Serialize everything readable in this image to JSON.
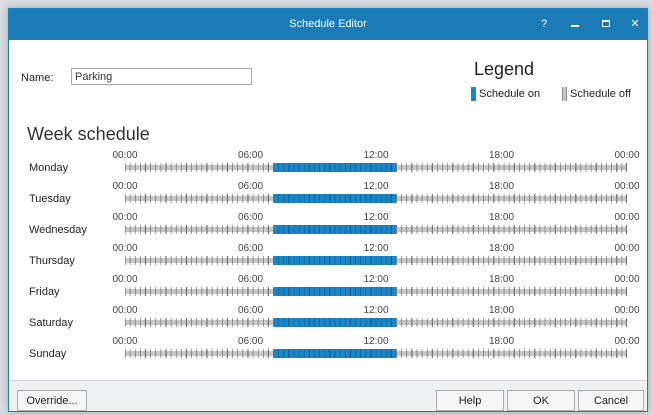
{
  "window": {
    "title": "Schedule Editor",
    "help_glyph": "?",
    "close_glyph": "✕"
  },
  "name": {
    "label": "Name:",
    "value": "Parking"
  },
  "legend": {
    "title": "Legend",
    "on_label": "Schedule on",
    "off_label": "Schedule off"
  },
  "week": {
    "title": "Week schedule",
    "tick_labels": [
      "00:00",
      "06:00",
      "12:00",
      "18:00",
      "00:00"
    ],
    "days": [
      {
        "label": "Monday",
        "on_start": 7,
        "on_end": 13
      },
      {
        "label": "Tuesday",
        "on_start": 7,
        "on_end": 13
      },
      {
        "label": "Wednesday",
        "on_start": 7,
        "on_end": 13
      },
      {
        "label": "Thursday",
        "on_start": 7,
        "on_end": 13
      },
      {
        "label": "Friday",
        "on_start": 7,
        "on_end": 13
      },
      {
        "label": "Saturday",
        "on_start": 7,
        "on_end": 13
      },
      {
        "label": "Sunday",
        "on_start": 7,
        "on_end": 13
      }
    ]
  },
  "buttons": {
    "override": "Override...",
    "help": "Help",
    "ok": "OK",
    "cancel": "Cancel"
  },
  "colors": {
    "accent": "#1a7bb6",
    "schedule_on": "#1a86c8",
    "schedule_off": "#c8c8c8",
    "tick": "#6e6e6e"
  },
  "icons": {
    "help": "question-mark-icon",
    "minimize": "minimize-icon",
    "maximize": "maximize-icon",
    "close": "close-icon"
  }
}
